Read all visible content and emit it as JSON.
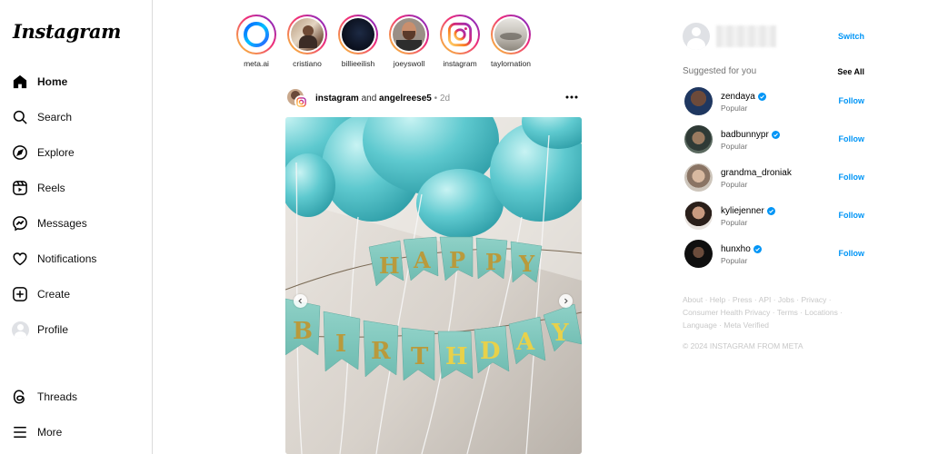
{
  "app": {
    "logo_text": "Instagram"
  },
  "sidebar": {
    "items": [
      {
        "label": "Home",
        "icon": "home-icon",
        "active": true
      },
      {
        "label": "Search",
        "icon": "search-icon"
      },
      {
        "label": "Explore",
        "icon": "explore-compass-icon"
      },
      {
        "label": "Reels",
        "icon": "reels-icon"
      },
      {
        "label": "Messages",
        "icon": "messenger-icon"
      },
      {
        "label": "Notifications",
        "icon": "heart-icon"
      },
      {
        "label": "Create",
        "icon": "plus-square-icon"
      },
      {
        "label": "Profile",
        "icon": "profile-avatar-icon"
      }
    ],
    "bottom_items": [
      {
        "label": "Threads",
        "icon": "threads-icon"
      },
      {
        "label": "More",
        "icon": "hamburger-menu-icon"
      }
    ]
  },
  "stories": [
    {
      "name": "meta.ai"
    },
    {
      "name": "cristiano"
    },
    {
      "name": "billieeilish"
    },
    {
      "name": "joeyswoll"
    },
    {
      "name": "instagram"
    },
    {
      "name": "taylornation"
    }
  ],
  "post": {
    "author1": "instagram",
    "joiner": "and",
    "author2": "angelreese5",
    "separator": "•",
    "time": "2d",
    "image_alt": "Teal balloons and a HAPPY BIRTHDAY banner"
  },
  "right": {
    "switch_label": "Switch",
    "suggested_title": "Suggested for you",
    "see_all": "See All",
    "suggestions": [
      {
        "username": "zendaya",
        "verified": true,
        "subtitle": "Popular",
        "action": "Follow"
      },
      {
        "username": "badbunnypr",
        "verified": true,
        "subtitle": "Popular",
        "action": "Follow"
      },
      {
        "username": "grandma_droniak",
        "verified": false,
        "subtitle": "Popular",
        "action": "Follow"
      },
      {
        "username": "kyliejenner",
        "verified": true,
        "subtitle": "Popular",
        "action": "Follow"
      },
      {
        "username": "hunxho",
        "verified": true,
        "subtitle": "Popular",
        "action": "Follow"
      }
    ],
    "footer_line1": [
      "About",
      "Help",
      "Press",
      "API",
      "Jobs",
      "Privacy"
    ],
    "footer_line2": [
      "Consumer Health Privacy",
      "Terms",
      "Locations"
    ],
    "footer_line3": [
      "Language",
      "Meta Verified"
    ],
    "copyright": "© 2024 INSTAGRAM FROM META"
  },
  "colors": {
    "accent": "#0095f6",
    "border": "#dbdbdb",
    "muted": "#737373"
  }
}
